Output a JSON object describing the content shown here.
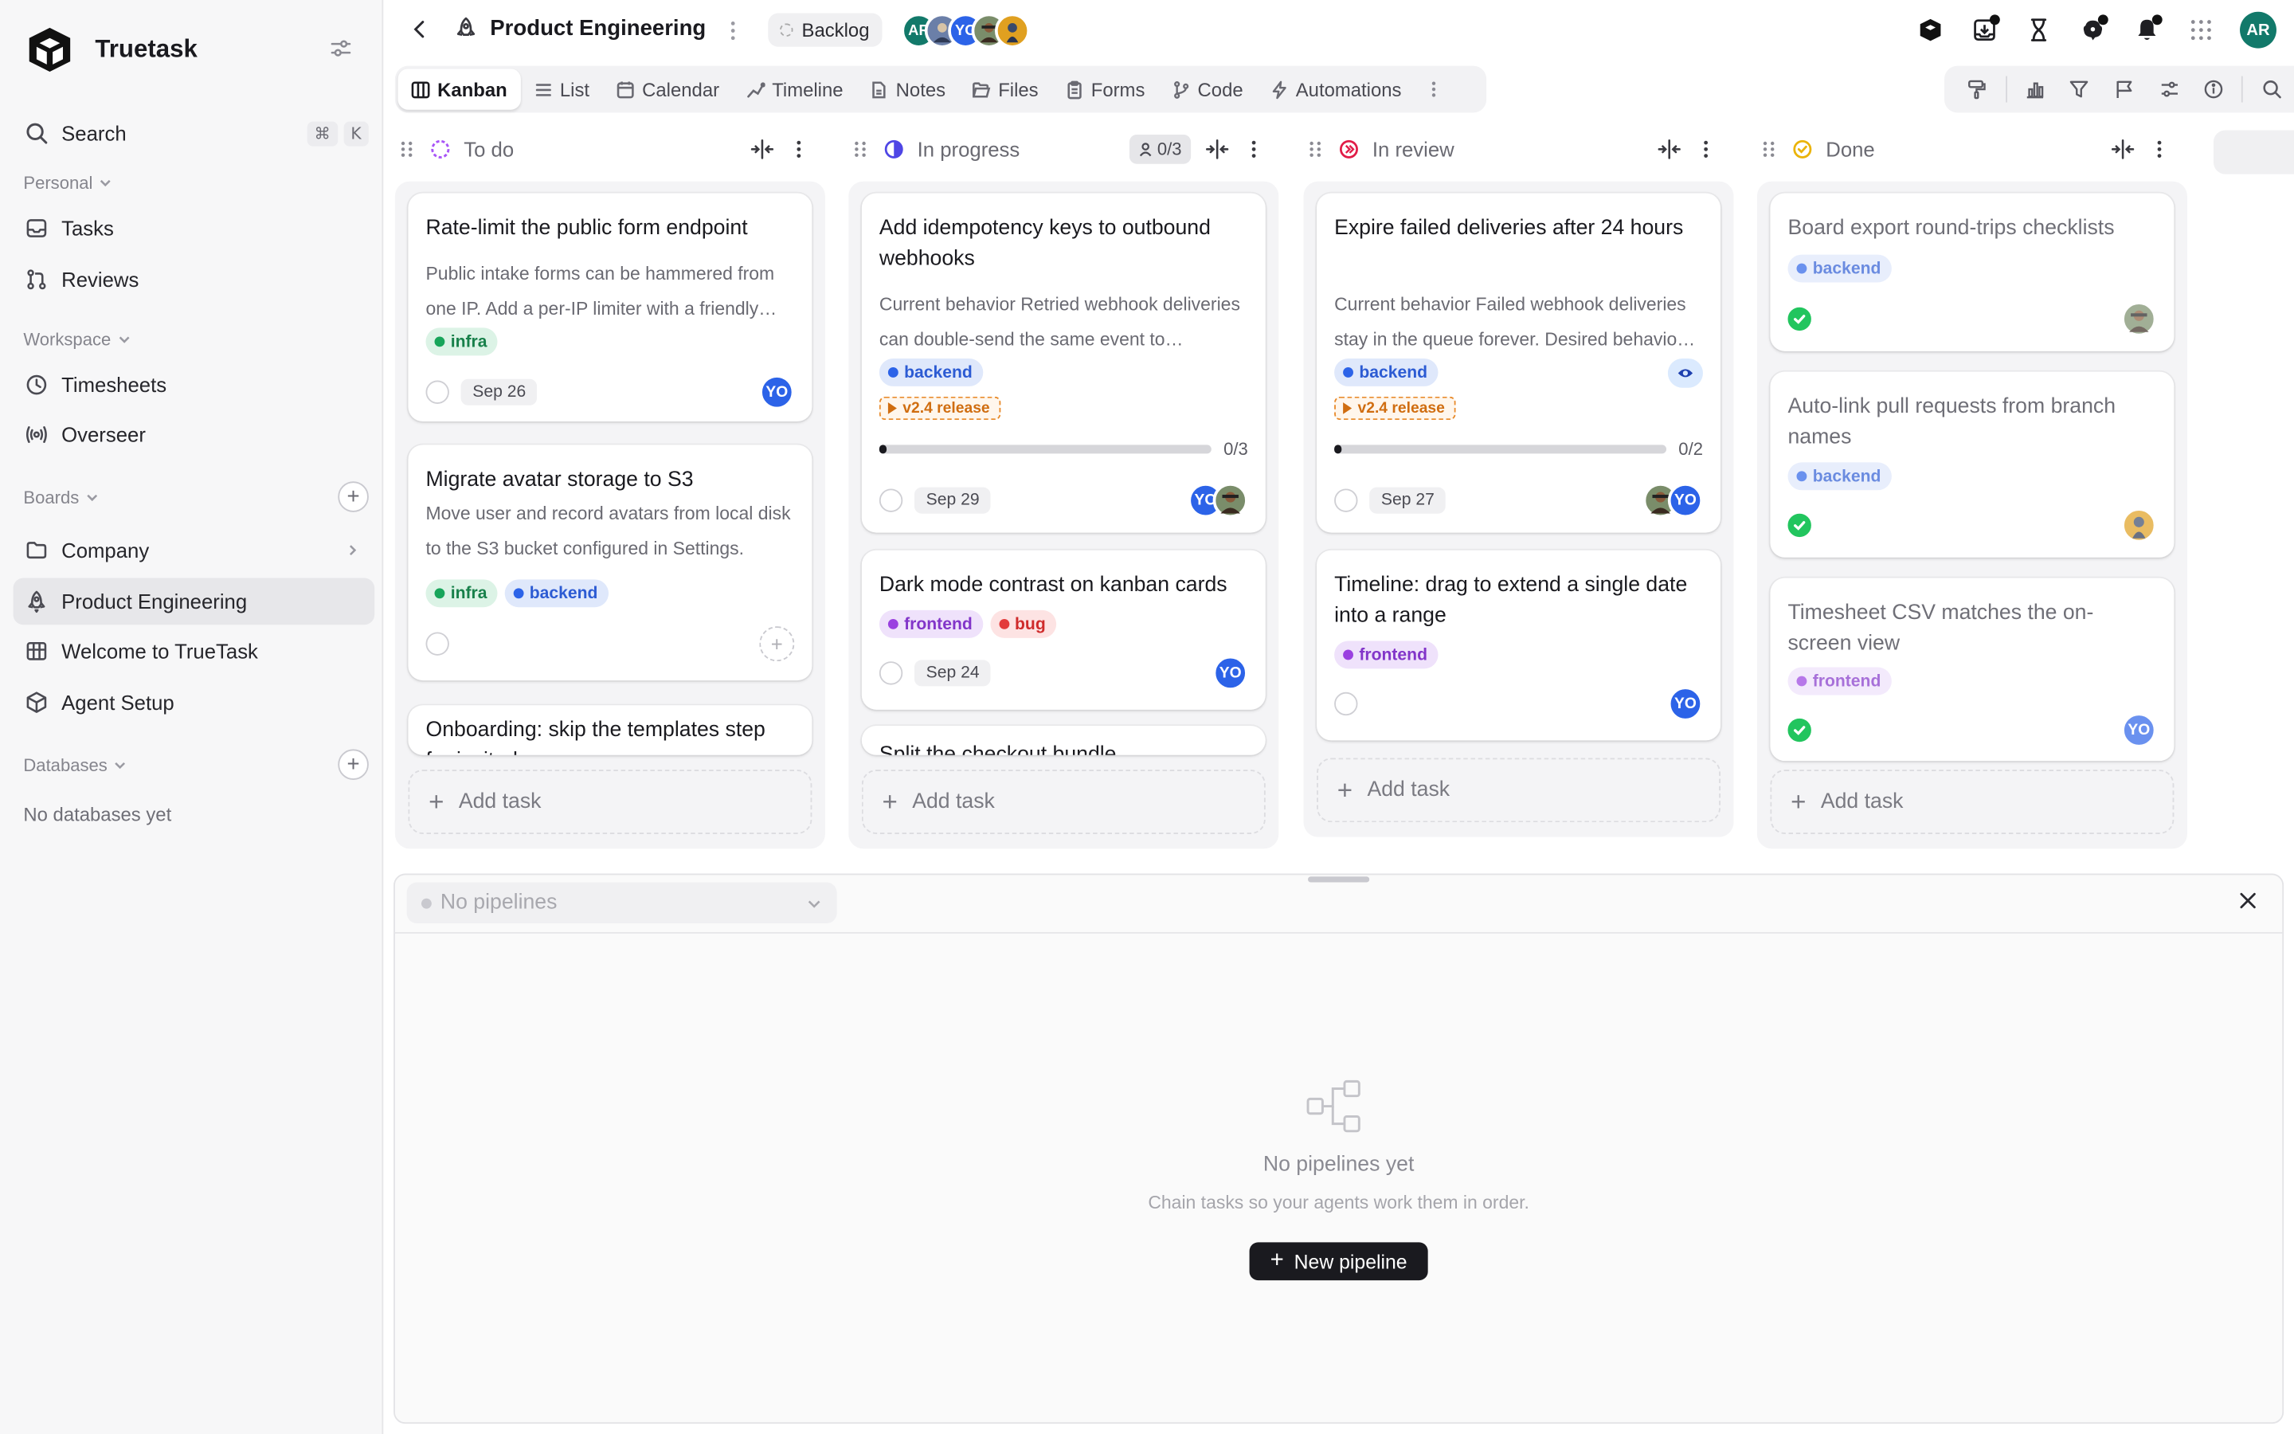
{
  "app": {
    "name": "Truetask"
  },
  "sidebar": {
    "search": {
      "label": "Search",
      "shortcut": [
        "⌘",
        "K"
      ]
    },
    "personal": {
      "label": "Personal",
      "items": [
        {
          "label": "Tasks",
          "icon": "inbox-icon"
        },
        {
          "label": "Reviews",
          "icon": "pull-request-icon"
        }
      ]
    },
    "workspace": {
      "label": "Workspace",
      "items": [
        {
          "label": "Timesheets",
          "icon": "clock-icon"
        },
        {
          "label": "Overseer",
          "icon": "broadcast-icon"
        }
      ]
    },
    "boards": {
      "label": "Boards",
      "items": [
        {
          "label": "Company",
          "icon": "folder-icon"
        },
        {
          "label": "Product Engineering",
          "icon": "rocket-icon",
          "active": true
        },
        {
          "label": "Welcome to TrueTask",
          "icon": "board-icon"
        },
        {
          "label": "Agent Setup",
          "icon": "cube-icon"
        }
      ]
    },
    "databases": {
      "label": "Databases",
      "empty": "No databases yet"
    }
  },
  "header": {
    "title": "Product Engineering",
    "backlog_label": "Backlog",
    "user_initials": "AR"
  },
  "presence": [
    {
      "initials": "AR",
      "color": "#12796a"
    },
    {
      "initials": "",
      "color": "#6b7fa8"
    },
    {
      "initials": "YO",
      "color": "#2c63e8"
    },
    {
      "initials": "",
      "color": "#7a8d6a"
    },
    {
      "initials": "",
      "color": "#e0a020"
    }
  ],
  "tabs": [
    "Kanban",
    "List",
    "Calendar",
    "Timeline",
    "Notes",
    "Files",
    "Forms",
    "Code",
    "Automations"
  ],
  "columns": {
    "todo": {
      "title": "To do",
      "cards": [
        {
          "title": "Rate-limit the public form endpoint",
          "desc": "Public intake forms can be hammered from one IP. Add a per-IP limiter with a friendly error page.",
          "tags": [
            "infra"
          ],
          "due": "Sep 26",
          "assignee": "YO"
        },
        {
          "title": "Migrate avatar storage to S3",
          "desc": "Move user and record avatars from local disk to the S3 bucket configured in Settings.",
          "tags": [
            "infra",
            "backend"
          ]
        },
        {
          "title": "Onboarding: skip the templates step for invited users"
        }
      ],
      "add_label": "Add task"
    },
    "inprogress": {
      "title": "In progress",
      "wip": "0/3",
      "cards": [
        {
          "title": "Add idempotency keys to outbound webhooks",
          "desc": "Current behavior Retried webhook deliveries can double-send the same event to subscribers.",
          "tags": [
            "backend"
          ],
          "release": "v2.4 release",
          "progress_label": "0/3",
          "progress": 0.02,
          "due": "Sep 29",
          "assignee": "YO"
        },
        {
          "title": "Dark mode contrast on kanban cards",
          "tags": [
            "frontend",
            "bug"
          ],
          "due": "Sep 24",
          "assignee": "YO"
        },
        {
          "title": "Split the checkout bundle"
        }
      ],
      "add_label": "Add task"
    },
    "review": {
      "title": "In review",
      "cards": [
        {
          "title": "Expire failed deliveries after 24 hours",
          "desc": "Current behavior Failed webhook deliveries stay in the queue forever. Desired behavior expire them.",
          "tags": [
            "backend"
          ],
          "release": "v2.4 release",
          "progress_label": "0/2",
          "progress": 0.02,
          "due": "Sep 27",
          "assignee": "YO"
        },
        {
          "title": "Timeline: drag to extend a single date into a range",
          "tags": [
            "frontend"
          ],
          "assignee": "YO"
        }
      ],
      "add_label": "Add task"
    },
    "done": {
      "title": "Done",
      "cards": [
        {
          "title": "Board export round-trips checklists",
          "tags": [
            "backend"
          ]
        },
        {
          "title": "Auto-link pull requests from branch names",
          "tags": [
            "backend"
          ]
        },
        {
          "title": "Timesheet CSV matches the on-screen view",
          "tags": [
            "frontend"
          ],
          "assignee": "YO"
        }
      ],
      "add_label": "Add task"
    }
  },
  "pipelines": {
    "select_placeholder": "No pipelines",
    "empty_title": "No pipelines yet",
    "empty_subtitle": "Chain tasks so your agents work them in order.",
    "new_button": "New pipeline"
  },
  "colors": {
    "accent": "#2c63e8",
    "done": "#22c55e",
    "release": "#e88a2a"
  }
}
